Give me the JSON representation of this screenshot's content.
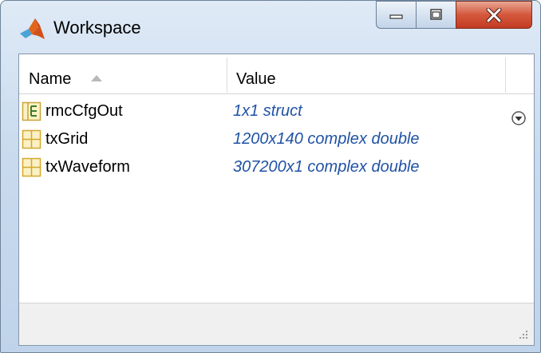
{
  "window": {
    "title": "Workspace",
    "logo": "matlab-logo-icon"
  },
  "table": {
    "columns": [
      {
        "label": "Name",
        "sort": "ascending"
      },
      {
        "label": "Value"
      }
    ],
    "rows": [
      {
        "name": "rmcCfgOut",
        "value": "1x1 struct",
        "icon": "struct-icon"
      },
      {
        "name": "txGrid",
        "value": "1200x140 complex double",
        "icon": "matrix-icon"
      },
      {
        "name": "txWaveform",
        "value": "307200x1 complex double",
        "icon": "matrix-icon"
      }
    ]
  },
  "colors": {
    "value_text": "#1f52a5",
    "title_gradient_top": "#dfeaf6",
    "close_button": "#c23b22"
  }
}
